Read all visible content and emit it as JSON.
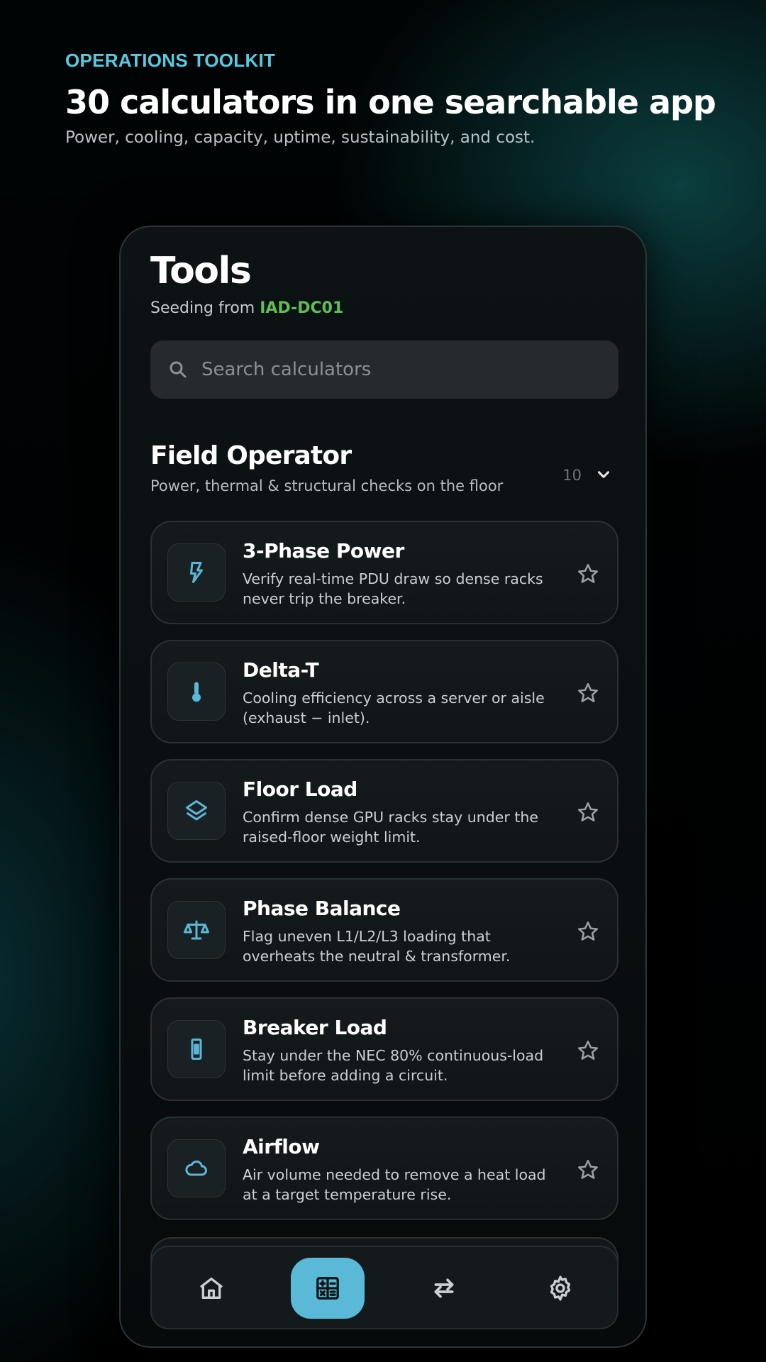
{
  "hero": {
    "eyebrow": "OPERATIONS TOOLKIT",
    "headline": "30 calculators in one searchable app",
    "subhead": "Power, cooling, capacity, uptime, sustainability, and cost."
  },
  "screen": {
    "title": "Tools",
    "seed_prefix": "Seeding from",
    "seed_site": "IAD-DC01",
    "search": {
      "placeholder": "Search calculators",
      "value": "",
      "icon": "search-icon"
    }
  },
  "section": {
    "title": "Field Operator",
    "subtitle": "Power, thermal & structural checks on the floor",
    "count": "10",
    "expanded": true
  },
  "cards": [
    {
      "title": "3-Phase Power",
      "description": "Verify real-time PDU draw so dense racks never trip the breaker.",
      "icon": "lightning-bolt-icon"
    },
    {
      "title": "Delta-T",
      "description": "Cooling efficiency across a server or aisle (exhaust − inlet).",
      "icon": "thermometer-icon"
    },
    {
      "title": "Floor Load",
      "description": "Confirm dense GPU racks stay under the raised-floor weight limit.",
      "icon": "layers-icon"
    },
    {
      "title": "Phase Balance",
      "description": "Flag uneven L1/L2/L3 loading that overheats the neutral & transformer.",
      "icon": "scale-icon"
    },
    {
      "title": "Breaker Load",
      "description": "Stay under the NEC 80% continuous-load limit before adding a circuit.",
      "icon": "fuse-icon"
    },
    {
      "title": "Airflow",
      "description": "Air volume needed to remove a heat load at a target temperature rise.",
      "icon": "cloud-icon"
    }
  ],
  "nav": {
    "items": [
      {
        "name": "home",
        "icon": "home-icon",
        "active": false
      },
      {
        "name": "tools",
        "icon": "calculator-icon",
        "active": true
      },
      {
        "name": "transfer",
        "icon": "swap-arrows-icon",
        "active": false
      },
      {
        "name": "settings",
        "icon": "gear-icon",
        "active": false
      }
    ]
  },
  "colors": {
    "accent": "#57cbe0",
    "site_green": "#5fbf56",
    "icon_blue": "#5ab8d6",
    "nav_active": "#59b9d6"
  }
}
